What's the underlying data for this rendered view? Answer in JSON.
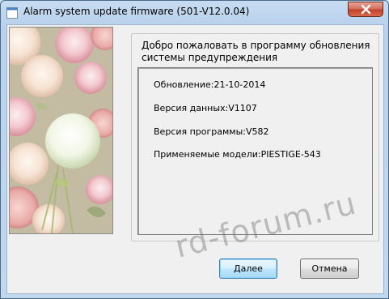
{
  "window": {
    "title": "Alarm system update firmware (501-V12.0.04)"
  },
  "welcome_text": "Добро пожаловать в программу обновления системы предупреждения",
  "info": {
    "update": "Обновление:21-10-2014",
    "data_version": "Версия данных:V1107",
    "program_version": "Версия программы:V582",
    "models": "Применяемые модели:PIESTIGE-543"
  },
  "buttons": {
    "next": "Далее",
    "cancel": "Отмена"
  },
  "watermark": "rd-forum.ru",
  "icons": {
    "app": "window-app-icon",
    "close": "close-icon",
    "photo": "flowers-bouquet-image"
  }
}
